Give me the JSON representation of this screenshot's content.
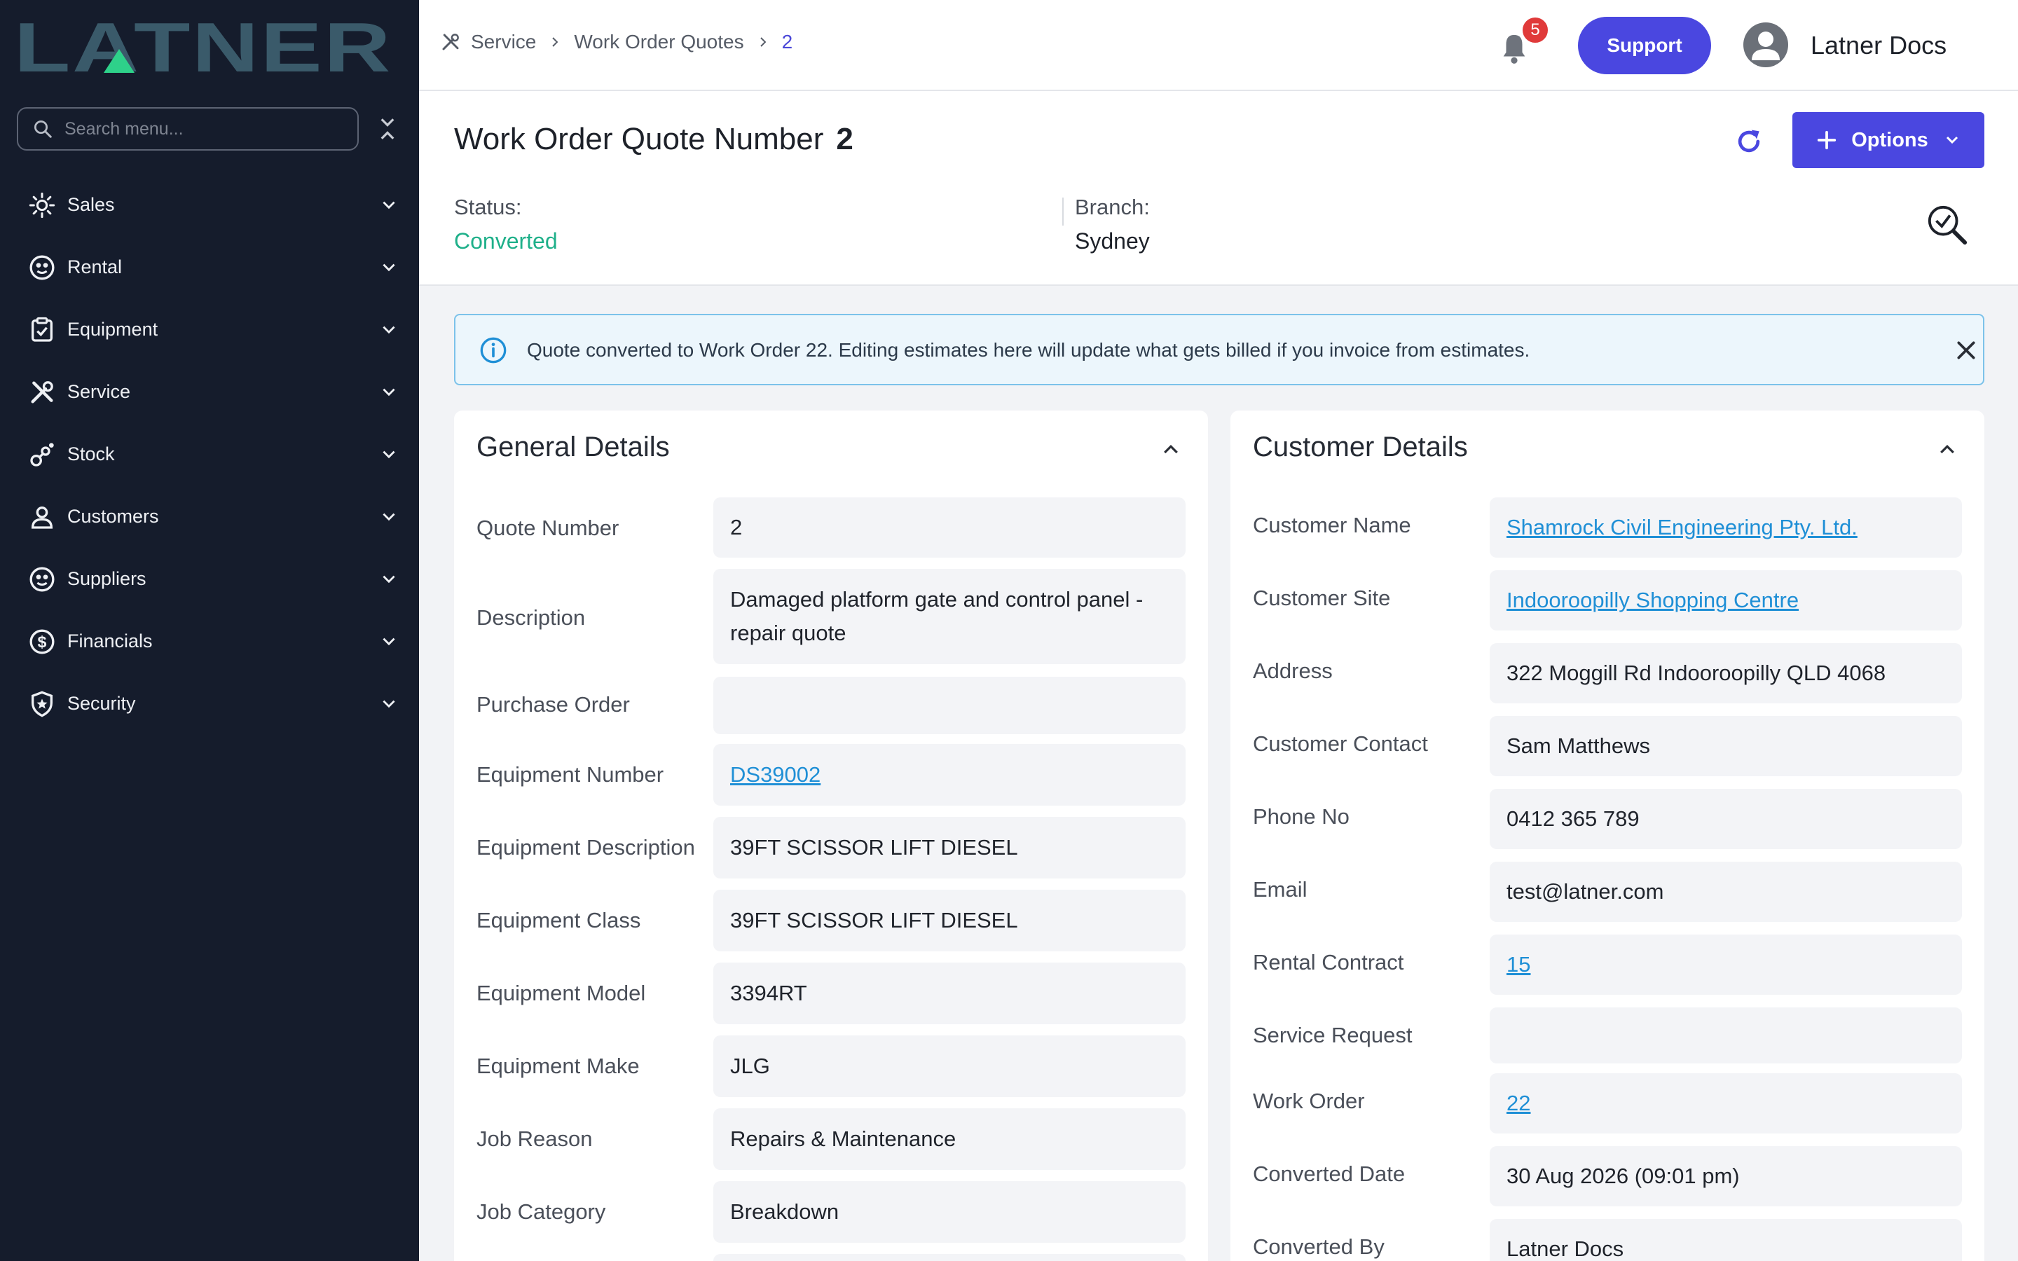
{
  "brand": {
    "logo_text": "LATNER"
  },
  "sidebar": {
    "search_placeholder": "Search menu...",
    "items": [
      {
        "label": "Sales",
        "icon": "sales-icon"
      },
      {
        "label": "Rental",
        "icon": "rental-icon"
      },
      {
        "label": "Equipment",
        "icon": "equipment-icon"
      },
      {
        "label": "Service",
        "icon": "service-icon"
      },
      {
        "label": "Stock",
        "icon": "stock-icon"
      },
      {
        "label": "Customers",
        "icon": "customers-icon"
      },
      {
        "label": "Suppliers",
        "icon": "suppliers-icon"
      },
      {
        "label": "Financials",
        "icon": "financials-icon"
      },
      {
        "label": "Security",
        "icon": "security-icon"
      }
    ]
  },
  "topbar": {
    "breadcrumbs": [
      "Service",
      "Work Order Quotes",
      "2"
    ],
    "notification_count": "5",
    "support_label": "Support",
    "user_name": "Latner Docs"
  },
  "header": {
    "title": "Work Order Quote Number",
    "number": "2",
    "options_label": "Options",
    "status_label": "Status:",
    "status_value": "Converted",
    "branch_label": "Branch:",
    "branch_value": "Sydney"
  },
  "alert": {
    "message": "Quote converted to Work Order 22. Editing estimates here will update what gets billed if you invoice from estimates."
  },
  "general": {
    "title": "General Details",
    "rows": [
      {
        "label": "Quote Number",
        "value": "2"
      },
      {
        "label": "Description",
        "value": "Damaged platform gate and control panel - repair quote"
      },
      {
        "label": "Purchase Order",
        "value": ""
      },
      {
        "label": "Equipment Number",
        "value": "DS39002"
      },
      {
        "label": "Equipment Description",
        "value": "39FT SCISSOR LIFT DIESEL"
      },
      {
        "label": "Equipment Class",
        "value": "39FT SCISSOR LIFT DIESEL"
      },
      {
        "label": "Equipment Model",
        "value": "3394RT"
      },
      {
        "label": "Equipment Make",
        "value": "JLG"
      },
      {
        "label": "Job Reason",
        "value": "Repairs & Maintenance"
      },
      {
        "label": "Job Category",
        "value": "Breakdown"
      }
    ]
  },
  "customer": {
    "title": "Customer Details",
    "rows": [
      {
        "label": "Customer Name",
        "value": "Shamrock Civil Engineering Pty. Ltd."
      },
      {
        "label": "Customer Site",
        "value": "Indooroopilly Shopping Centre"
      },
      {
        "label": "Address",
        "value": "322 Moggill Rd Indooroopilly QLD 4068"
      },
      {
        "label": "Customer Contact",
        "value": "Sam Matthews"
      },
      {
        "label": "Phone No",
        "value": "0412 365 789"
      },
      {
        "label": "Email",
        "value": "test@latner.com"
      },
      {
        "label": "Rental Contract",
        "value": "15"
      },
      {
        "label": "Service Request",
        "value": ""
      },
      {
        "label": "Work Order",
        "value": "22"
      },
      {
        "label": "Converted Date",
        "value": "30 Aug 2026 (09:01 pm)"
      },
      {
        "label": "Converted By",
        "value": "Latner Docs"
      }
    ]
  },
  "colors": {
    "accent": "#4a47e0",
    "status_converted": "#1fb08a",
    "link": "#1f8fd6",
    "sidebar_bg": "#151c2c"
  }
}
